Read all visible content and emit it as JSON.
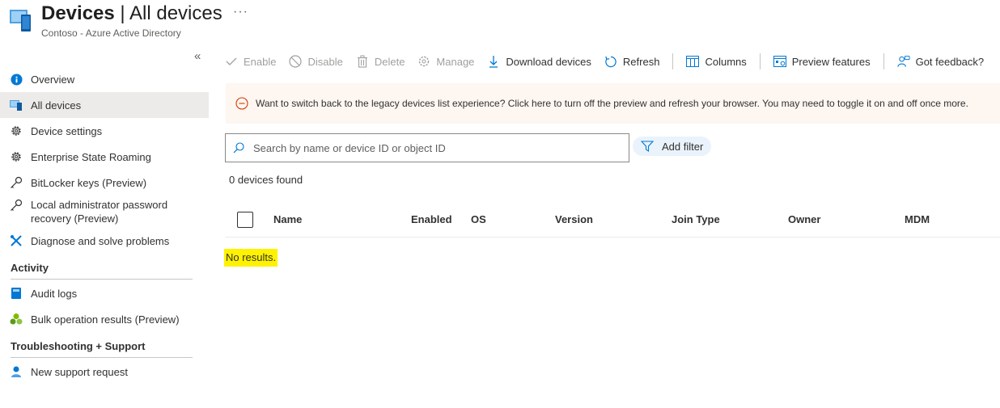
{
  "header": {
    "title_main": "Devices",
    "title_sep": " | ",
    "title_sub": "All devices",
    "subtitle": "Contoso - Azure Active Directory",
    "more_label": "···"
  },
  "sidebar": {
    "collapse_label": "«",
    "items": [
      {
        "label": "Overview",
        "icon": "info-icon"
      },
      {
        "label": "All devices",
        "icon": "devices-icon"
      },
      {
        "label": "Device settings",
        "icon": "gear-icon"
      },
      {
        "label": "Enterprise State Roaming",
        "icon": "gear-icon"
      },
      {
        "label": "BitLocker keys (Preview)",
        "icon": "key-icon"
      },
      {
        "label": "Local administrator password recovery (Preview)",
        "icon": "key-icon"
      },
      {
        "label": "Diagnose and solve problems",
        "icon": "wrench-icon"
      }
    ],
    "sections": [
      {
        "label": "Activity",
        "items": [
          {
            "label": "Audit logs",
            "icon": "book-icon"
          },
          {
            "label": "Bulk operation results (Preview)",
            "icon": "cluster-icon"
          }
        ]
      },
      {
        "label": "Troubleshooting + Support",
        "items": [
          {
            "label": "New support request",
            "icon": "person-support-icon"
          }
        ]
      }
    ]
  },
  "toolbar": {
    "enable": "Enable",
    "disable": "Disable",
    "delete": "Delete",
    "manage": "Manage",
    "download": "Download devices",
    "refresh": "Refresh",
    "columns": "Columns",
    "preview": "Preview features",
    "feedback": "Got feedback?"
  },
  "banner": {
    "text": "Want to switch back to the legacy devices list experience? Click here to turn off the preview and refresh your browser. You may need to toggle it on and off once more.",
    "color": "#fdf6f1",
    "icon_color": "#d83b01"
  },
  "search": {
    "placeholder": "Search by name or device ID or object ID",
    "value": ""
  },
  "filter": {
    "label": "Add filter"
  },
  "results": {
    "count_text": "0 devices found",
    "empty_text": "No results."
  },
  "table": {
    "columns": [
      "Name",
      "Enabled",
      "OS",
      "Version",
      "Join Type",
      "Owner",
      "MDM"
    ]
  },
  "colors": {
    "accent": "#0078d4",
    "highlight": "#fff200"
  }
}
